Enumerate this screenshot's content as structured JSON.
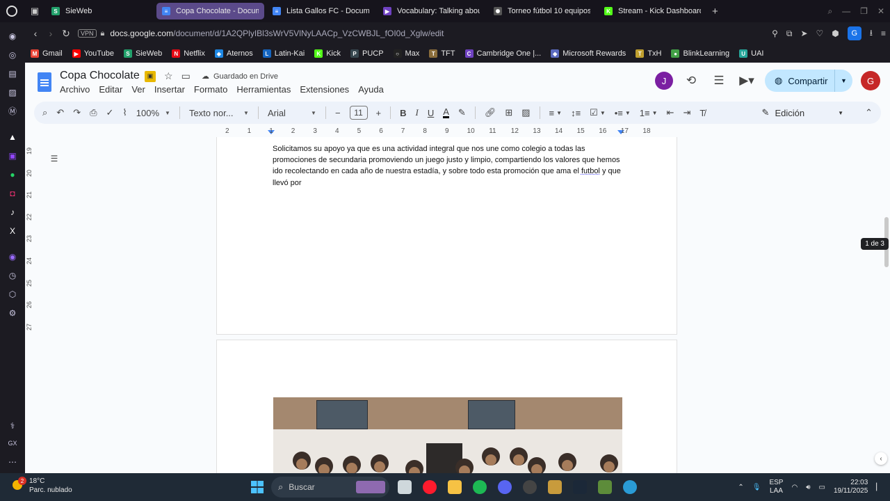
{
  "browser": {
    "tabs": [
      {
        "label": "SieWeb",
        "color": "#22a06b",
        "glyph": "S",
        "active": false
      },
      {
        "label": "Copa Chocolate - Docum",
        "color": "#4285f4",
        "glyph": "≡",
        "active": true
      },
      {
        "label": "Lista Gallos FC - Docume",
        "color": "#4285f4",
        "glyph": "≡",
        "active": false
      },
      {
        "label": "Vocabulary: Talking abou",
        "color": "#6f42c1",
        "glyph": "▶",
        "active": false
      },
      {
        "label": "Torneo fútbol 10 equipos",
        "color": "#555555",
        "glyph": "✺",
        "active": false
      },
      {
        "label": "Stream - Kick Dashboard",
        "color": "#53fc18",
        "glyph": "K",
        "active": false
      }
    ],
    "new_tab": "+",
    "vpn": "VPN",
    "url_host": "docs.google.com",
    "url_path": "/document/d/1A2QPlyIBl3sWrV5VlNyLAACp_VzCWBJL_fOI0d_Xglw/edit",
    "profile_initial": "G",
    "bookmarks": [
      {
        "label": "Gmail",
        "color": "#ea4335",
        "glyph": "M"
      },
      {
        "label": "YouTube",
        "color": "#ff0000",
        "glyph": "▶"
      },
      {
        "label": "SieWeb",
        "color": "#22a06b",
        "glyph": "S"
      },
      {
        "label": "Netflix",
        "color": "#e50914",
        "glyph": "N"
      },
      {
        "label": "Aternos",
        "color": "#1e88e5",
        "glyph": "◈"
      },
      {
        "label": "Latin-Kai",
        "color": "#1565c0",
        "glyph": "L"
      },
      {
        "label": "Kick",
        "color": "#53fc18",
        "glyph": "K"
      },
      {
        "label": "PUCP",
        "color": "#37474f",
        "glyph": "P"
      },
      {
        "label": "Max",
        "color": "#222222",
        "glyph": "○"
      },
      {
        "label": "TFT",
        "color": "#8a6d3b",
        "glyph": "T"
      },
      {
        "label": "Cambridge One |...",
        "color": "#6f42c1",
        "glyph": "C"
      },
      {
        "label": "Microsoft Rewards",
        "color": "#5c6bc0",
        "glyph": "◆"
      },
      {
        "label": "TxH",
        "color": "#c0a030",
        "glyph": "T"
      },
      {
        "label": "BlinkLearning",
        "color": "#43a047",
        "glyph": "●"
      },
      {
        "label": "UAI",
        "color": "#26a69a",
        "glyph": "U"
      }
    ]
  },
  "docs": {
    "title": "Copa Chocolate",
    "saved_status": "Guardado en Drive",
    "menu": [
      "Archivo",
      "Editar",
      "Ver",
      "Insertar",
      "Formato",
      "Herramientas",
      "Extensiones",
      "Ayuda"
    ],
    "collaborator_initial": "J",
    "user_initial": "G",
    "share_label": "Compartir",
    "zoom": "100%",
    "style": "Texto nor...",
    "font": "Arial",
    "font_size": "11",
    "mode": "Edición",
    "page_indicator": "1 de 3",
    "ruler_numbers": [
      "2",
      "1",
      "1",
      "2",
      "3",
      "4",
      "5",
      "6",
      "7",
      "8",
      "9",
      "10",
      "11",
      "12",
      "13",
      "14",
      "15",
      "16",
      "17",
      "18"
    ],
    "vruler_numbers": [
      "19",
      "20",
      "21",
      "22",
      "23",
      "24",
      "25",
      "26",
      "27"
    ],
    "paragraph_start": "Solicitamos su apoyo ya que es una actividad integral que nos une como colegio a todas las promociones de secundaria promoviendo un juego justo y limpio, compartiendo los valores que hemos ido recolectando en cada año de nuestra estadía, y sobre todo esta promoción que ama el ",
    "paragraph_underlined": "futbol",
    "paragraph_end": " y que llevó por"
  },
  "taskbar": {
    "temperature": "18°C",
    "weather": "Parc. nublado",
    "weather_badge": "2",
    "search_placeholder": "Buscar",
    "apps": [
      {
        "name": "file-icon",
        "color": "#cfd8dc"
      },
      {
        "name": "opera-icon",
        "color": "#ff1b2d"
      },
      {
        "name": "folder-icon",
        "color": "#f6c244"
      },
      {
        "name": "spotify-icon",
        "color": "#1db954"
      },
      {
        "name": "discord-icon",
        "color": "#5865f2"
      },
      {
        "name": "obs-icon",
        "color": "#444444"
      },
      {
        "name": "league-icon",
        "color": "#c89b3c"
      },
      {
        "name": "steam-icon",
        "color": "#1b2838"
      },
      {
        "name": "minecraft-icon",
        "color": "#5d8c3a"
      },
      {
        "name": "globe-app-icon",
        "color": "#2a9bd6"
      }
    ],
    "lang_top": "ESP",
    "lang_bottom": "LAA",
    "time": "22:03",
    "date": "19/11/2025"
  }
}
